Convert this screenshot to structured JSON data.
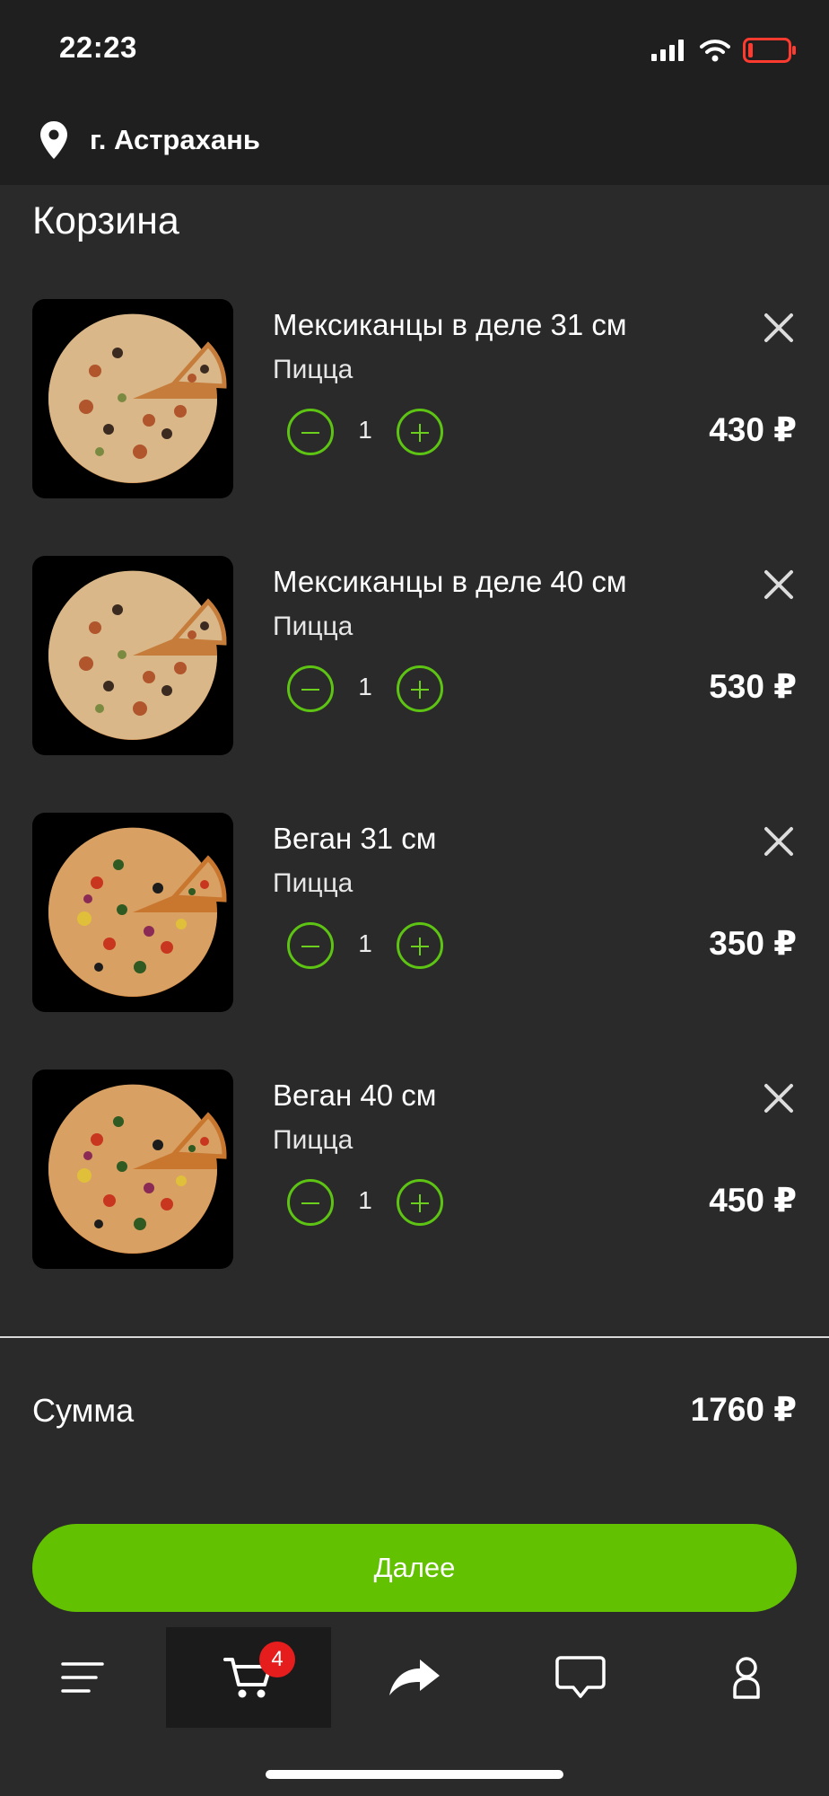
{
  "status": {
    "time": "22:23"
  },
  "location": {
    "city": "г. Астрахань"
  },
  "page": {
    "title": "Корзина"
  },
  "cart": {
    "items": [
      {
        "name": "Мексиканцы в деле 31 см",
        "category": "Пицца",
        "qty": "1",
        "price": "430 ₽",
        "image_icon": "pizza-image"
      },
      {
        "name": "Мексиканцы в деле 40 см",
        "category": "Пицца",
        "qty": "1",
        "price": "530 ₽",
        "image_icon": "pizza-image"
      },
      {
        "name": "Веган 31 см",
        "category": "Пицца",
        "qty": "1",
        "price": "350 ₽",
        "image_icon": "pizza-image"
      },
      {
        "name": "Веган 40 см",
        "category": "Пицца",
        "qty": "1",
        "price": "450 ₽",
        "image_icon": "pizza-image"
      }
    ]
  },
  "summary": {
    "label": "Сумма",
    "value": "1760 ₽"
  },
  "actions": {
    "next_label": "Далее"
  },
  "nav": {
    "items": [
      {
        "icon": "menu-icon"
      },
      {
        "icon": "cart-icon",
        "badge": "4",
        "active": true
      },
      {
        "icon": "share-icon"
      },
      {
        "icon": "chat-icon"
      },
      {
        "icon": "profile-icon"
      }
    ]
  },
  "colors": {
    "background": "#2a2a2a",
    "header": "#1f1f1f",
    "accent_green": "#62c100",
    "badge_red": "#e61d1d",
    "battery_red": "#ff3b30"
  }
}
